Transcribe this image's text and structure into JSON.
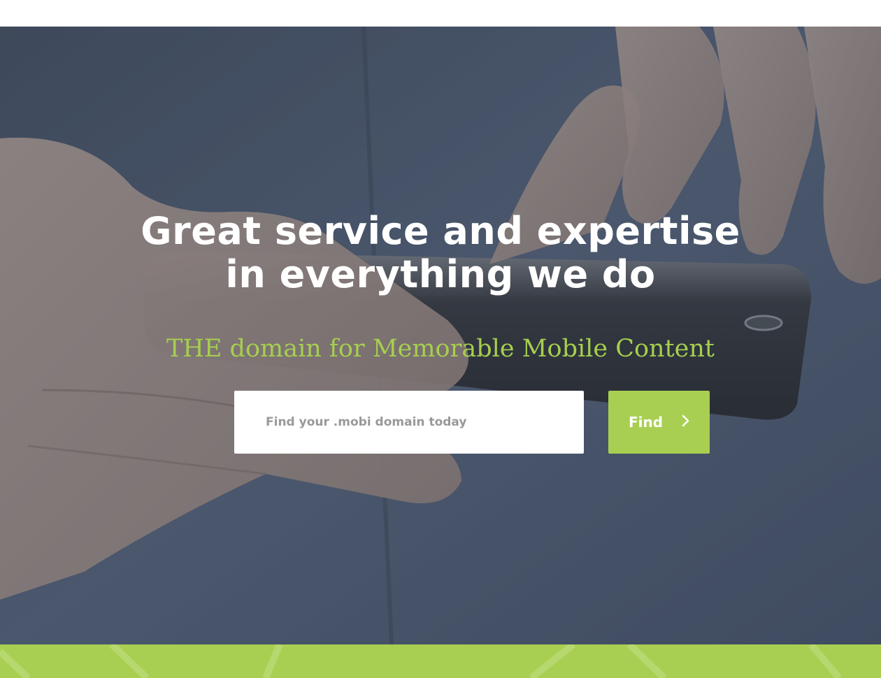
{
  "hero": {
    "headline_line1": "Great service and expertise",
    "headline_line2": "in everything we do",
    "tagline": "THE domain for Memorable Mobile Content"
  },
  "search": {
    "placeholder": "Find your .mobi domain today",
    "value": "",
    "button_label": "Find",
    "button_icon": "chevron-right-icon"
  },
  "colors": {
    "accent": "#a8cf52",
    "tagline": "#a6cf4f",
    "headline": "#ffffff"
  }
}
